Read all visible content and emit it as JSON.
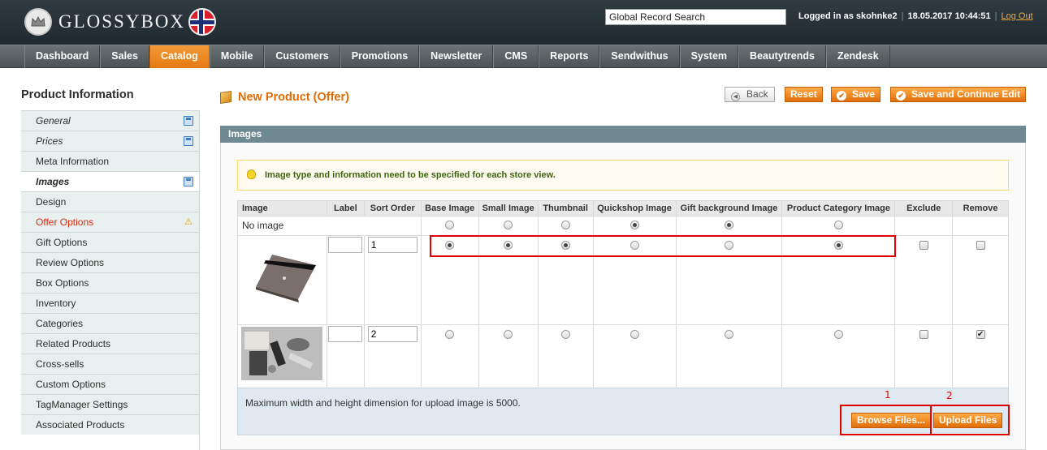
{
  "header": {
    "logo_text": "GLOSSYBOX",
    "search_placeholder": "Global Record Search",
    "logged_in": "Logged in as skohnke2",
    "datetime": "18.05.2017 10:44:51",
    "logout": "Log Out"
  },
  "nav": [
    "Dashboard",
    "Sales",
    "Catalog",
    "Mobile",
    "Customers",
    "Promotions",
    "Newsletter",
    "CMS",
    "Reports",
    "Sendwithus",
    "System",
    "Beautytrends",
    "Zendesk"
  ],
  "sidebar": {
    "title": "Product Information",
    "items": [
      "General",
      "Prices",
      "Meta Information",
      "Images",
      "Design",
      "Offer Options",
      "Gift Options",
      "Review Options",
      "Box Options",
      "Inventory",
      "Categories",
      "Related Products",
      "Cross-sells",
      "Custom Options",
      "TagManager Settings",
      "Associated Products"
    ]
  },
  "page": {
    "title": "New Product (Offer)",
    "back": "Back",
    "reset": "Reset",
    "save": "Save",
    "save_continue": "Save and Continue Edit"
  },
  "section": {
    "title": "Images",
    "notice": "Image type and information need to be specified for each store view."
  },
  "table": {
    "columns": [
      "Image",
      "Label",
      "Sort Order",
      "Base Image",
      "Small Image",
      "Thumbnail",
      "Quickshop Image",
      "Gift background Image",
      "Product Category Image",
      "Exclude",
      "Remove"
    ],
    "no_image_label": "No image",
    "rows": [
      {
        "label": "",
        "sort_order": "1"
      },
      {
        "label": "",
        "sort_order": "2"
      }
    ]
  },
  "footer": {
    "text": "Maximum width and height dimension for upload image is 5000.",
    "browse": "Browse Files...",
    "upload": "Upload Files"
  },
  "annotations": [
    "1",
    "2"
  ]
}
